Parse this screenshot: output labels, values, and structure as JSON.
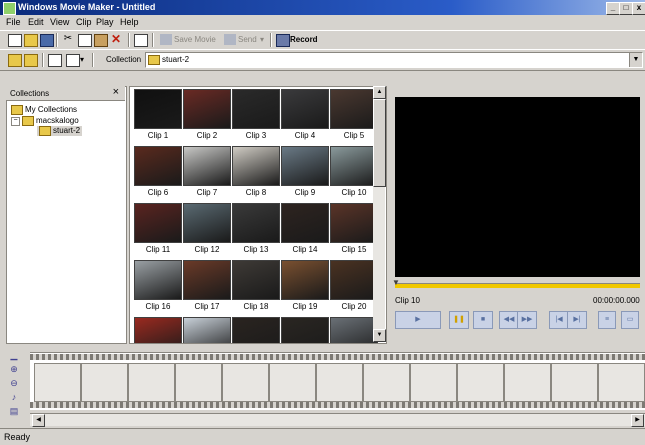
{
  "window": {
    "title": "Windows Movie Maker - Untitled",
    "minimize": "_",
    "maximize": "□",
    "close": "x"
  },
  "menu": [
    "File",
    "Edit",
    "View",
    "Clip",
    "Play",
    "Help"
  ],
  "toolbar": {
    "save_movie": "Save Movie",
    "send": "Send",
    "send_arrow": "▾",
    "record": "Record"
  },
  "collection_bar": {
    "label": "Collection",
    "value": "stuart-2"
  },
  "collections_pane": {
    "title": "Collections",
    "close": "×",
    "tree": [
      {
        "label": "My Collections",
        "indent": 0
      },
      {
        "label": "macskalogo",
        "indent": 1
      },
      {
        "label": "stuart-2",
        "indent": 2
      }
    ]
  },
  "clips": [
    {
      "label": "Clip 1",
      "color": "#101010"
    },
    {
      "label": "Clip 2",
      "color": "#6a2a24"
    },
    {
      "label": "Clip 3",
      "color": "#2a2a2a"
    },
    {
      "label": "Clip 4",
      "color": "#3a3a3c"
    },
    {
      "label": "Clip 5",
      "color": "#4a3830"
    },
    {
      "label": "Clip 6",
      "color": "#5a2a1e"
    },
    {
      "label": "Clip 7",
      "color": "#c8c8c6"
    },
    {
      "label": "Clip 8",
      "color": "#d0ccc4"
    },
    {
      "label": "Clip 9",
      "color": "#6a7a86"
    },
    {
      "label": "Clip 10",
      "color": "#8a9a9c"
    },
    {
      "label": "Clip 11",
      "color": "#5a2420"
    },
    {
      "label": "Clip 12",
      "color": "#5a6a72"
    },
    {
      "label": "Clip 13",
      "color": "#3a3a3a"
    },
    {
      "label": "Clip 14",
      "color": "#2e2420"
    },
    {
      "label": "Clip 15",
      "color": "#5a3428"
    },
    {
      "label": "Clip 16",
      "color": "#9aa0a4"
    },
    {
      "label": "Clip 17",
      "color": "#6a3a28"
    },
    {
      "label": "Clip 18",
      "color": "#3e3a36"
    },
    {
      "label": "Clip 19",
      "color": "#7a5030"
    },
    {
      "label": "Clip 20",
      "color": "#4a3222"
    },
    {
      "label": "",
      "color": "#9a2a20"
    },
    {
      "label": "",
      "color": "#c8d0d8"
    },
    {
      "label": "",
      "color": "#2a2420"
    },
    {
      "label": "",
      "color": "#2a2622"
    },
    {
      "label": "",
      "color": "#6a7076"
    }
  ],
  "monitor": {
    "clip_name": "Clip 10",
    "timecode": "00:00:00.000"
  },
  "status": {
    "text": "Ready"
  },
  "colors": {
    "title_bar": "#0a2a7a",
    "chrome": "#d6d3ce",
    "seek_bar": "#f0c800",
    "monitor": "#000000"
  }
}
